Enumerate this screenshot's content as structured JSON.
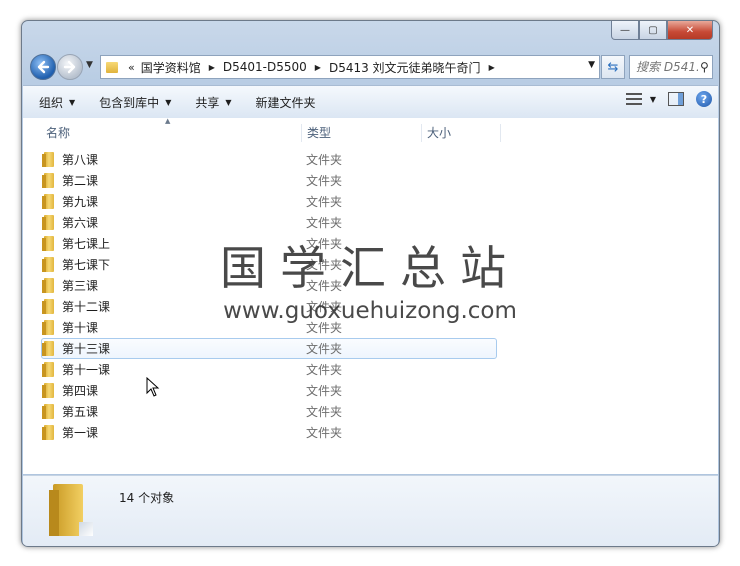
{
  "window": {
    "controls": {
      "minimize": "—",
      "maximize": "▢",
      "close": "✕"
    }
  },
  "address": {
    "overflow": "«",
    "crumbs": [
      "国学资料馆",
      "D5401-D5500",
      "D5413 刘文元徒弟晓午奇门"
    ]
  },
  "search": {
    "placeholder": "搜索 D541..."
  },
  "toolbar": {
    "organize": "组织",
    "include_in_library": "包含到库中",
    "share": "共享",
    "new_folder": "新建文件夹"
  },
  "columns": {
    "name": "名称",
    "type": "类型",
    "size": "大小"
  },
  "files": [
    {
      "name": "第八课",
      "type": "文件夹"
    },
    {
      "name": "第二课",
      "type": "文件夹"
    },
    {
      "name": "第九课",
      "type": "文件夹"
    },
    {
      "name": "第六课",
      "type": "文件夹"
    },
    {
      "name": "第七课上",
      "type": "文件夹"
    },
    {
      "name": "第七课下",
      "type": "文件夹"
    },
    {
      "name": "第三课",
      "type": "文件夹"
    },
    {
      "name": "第十二课",
      "type": "文件夹"
    },
    {
      "name": "第十课",
      "type": "文件夹"
    },
    {
      "name": "第十三课",
      "type": "文件夹",
      "selected": true
    },
    {
      "name": "第十一课",
      "type": "文件夹"
    },
    {
      "name": "第四课",
      "type": "文件夹"
    },
    {
      "name": "第五课",
      "type": "文件夹"
    },
    {
      "name": "第一课",
      "type": "文件夹"
    }
  ],
  "watermark": {
    "title": "国学汇总站",
    "url": "www.guoxuehuizong.com"
  },
  "details": {
    "count": "14 个对象"
  },
  "icons": [
    "back-arrow-icon",
    "forward-arrow-icon",
    "folder-icon",
    "refresh-icon",
    "search-icon",
    "view-list-icon",
    "preview-pane-icon",
    "help-icon",
    "mouse-cursor-icon"
  ]
}
